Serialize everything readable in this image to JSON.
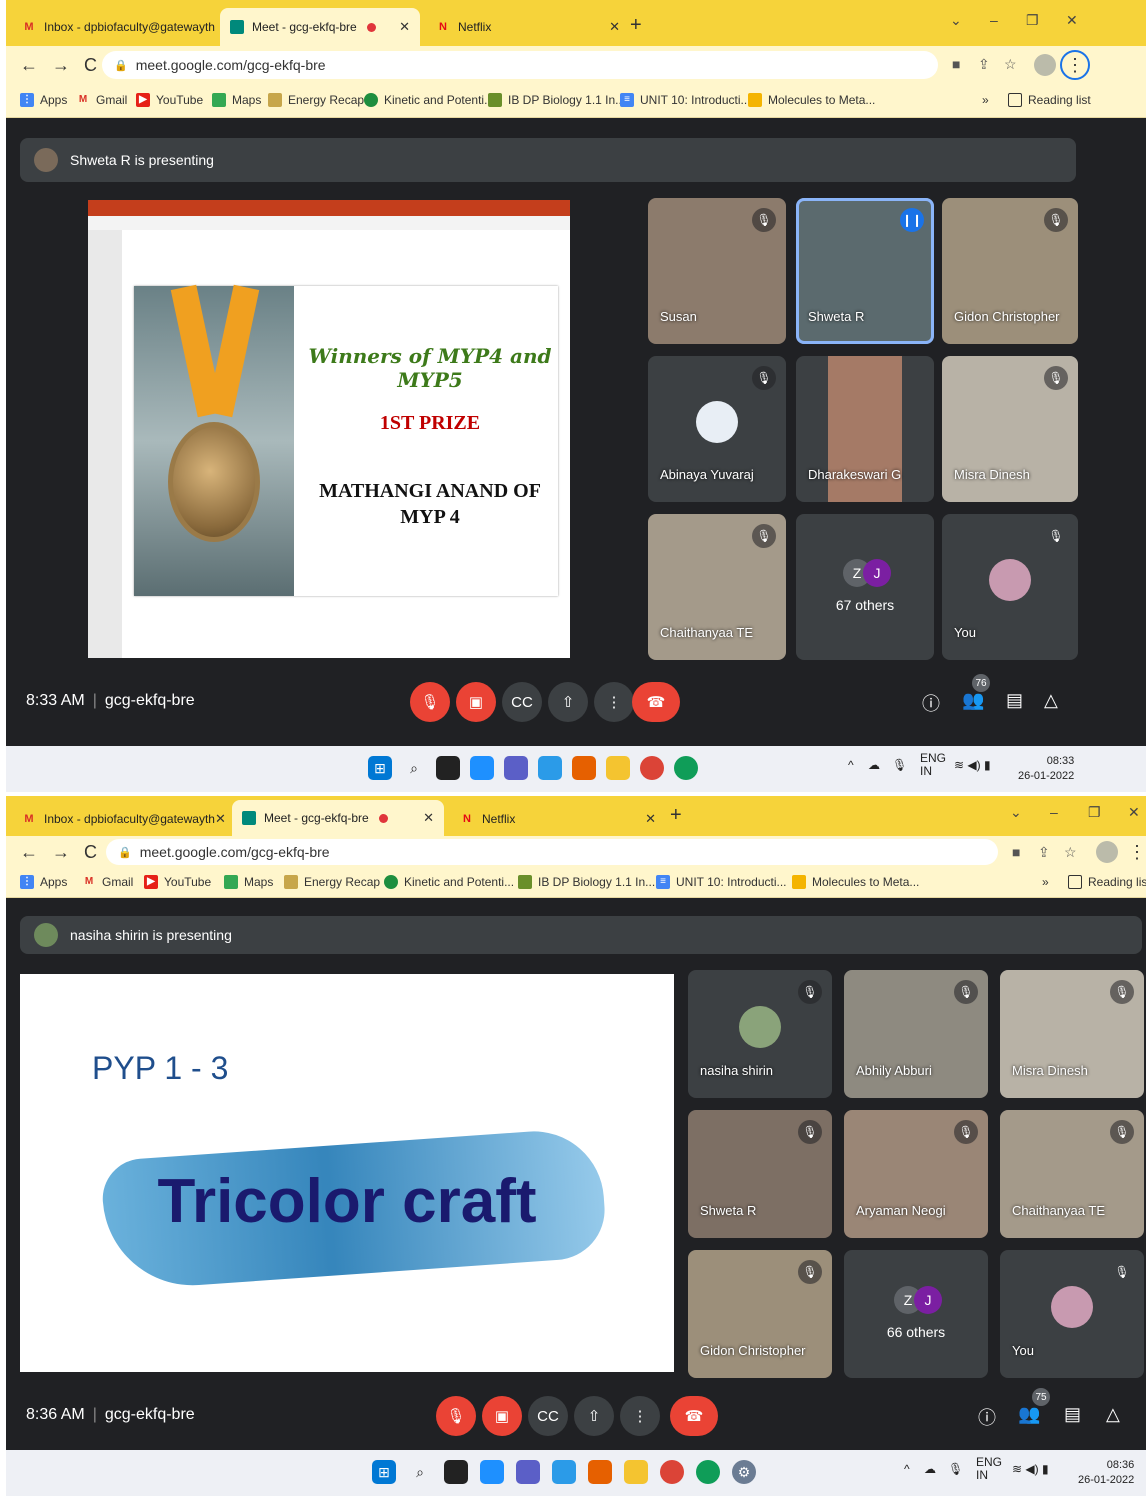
{
  "screens": [
    {
      "tabs": {
        "gmail": "Inbox - dpbiofaculty@gatewayth",
        "meet": "Meet - gcg-ekfq-bre",
        "netflix": "Netflix"
      },
      "url": "meet.google.com/gcg-ekfq-bre",
      "bookmarks": [
        "Apps",
        "Gmail",
        "YouTube",
        "Maps",
        "Energy Recap",
        "Kinetic and Potenti...",
        "IB DP Biology 1.1 In...",
        "UNIT 10: Introducti...",
        "Molecules to Meta..."
      ],
      "bookmarks_more": "»",
      "reading_list": "Reading list",
      "presenting": "Shweta R is presenting",
      "slide": {
        "title": "Winners of MYP4 and MYP5",
        "prize": "1ST PRIZE",
        "winner_line1": "MATHANGI ANAND OF",
        "winner_line2": "MYP 4"
      },
      "participants": [
        "Susan",
        "Shweta R",
        "Gidon Christopher",
        "Abinaya Yuvaraj",
        "Dharakeswari G",
        "Misra Dinesh",
        "Chaithanyaa TE"
      ],
      "others": "67 others",
      "you": "You",
      "overflow_initials": [
        "Z",
        "J"
      ],
      "time": "8:33 AM",
      "code": "gcg-ekfq-bre",
      "people_count": "76",
      "tray_lang": "ENG",
      "tray_region": "IN",
      "tray_time": "08:33",
      "tray_date": "26-01-2022"
    },
    {
      "tabs": {
        "gmail": "Inbox - dpbiofaculty@gatewayth",
        "meet": "Meet - gcg-ekfq-bre",
        "netflix": "Netflix"
      },
      "url": "meet.google.com/gcg-ekfq-bre",
      "bookmarks": [
        "Apps",
        "Gmail",
        "YouTube",
        "Maps",
        "Energy Recap",
        "Kinetic and Potenti...",
        "IB DP Biology 1.1 In...",
        "UNIT 10: Introducti...",
        "Molecules to Meta..."
      ],
      "bookmarks_more": "»",
      "reading_list": "Reading list",
      "presenting": "nasiha shirin is presenting",
      "slide": {
        "heading": "PYP 1 - 3",
        "title": "Tricolor craft"
      },
      "participants": [
        "nasiha shirin",
        "Abhily Abburi",
        "Misra Dinesh",
        "Shweta R",
        "Aryaman Neogi",
        "Chaithanyaa TE",
        "Gidon Christopher"
      ],
      "others": "66 others",
      "you": "You",
      "overflow_initials": [
        "Z",
        "J"
      ],
      "time": "8:36 AM",
      "code": "gcg-ekfq-bre",
      "people_count": "75",
      "tray_lang": "ENG",
      "tray_region": "IN",
      "tray_time": "08:36",
      "tray_date": "26-01-2022"
    }
  ],
  "colors": {
    "chrome_tabstrip": "#f6d33a",
    "chrome_toolbar": "#fff6cc",
    "meet_bg": "#202124",
    "tile_bg": "#3c4043",
    "danger": "#ea4335",
    "speaking": "#8ab4f8"
  }
}
